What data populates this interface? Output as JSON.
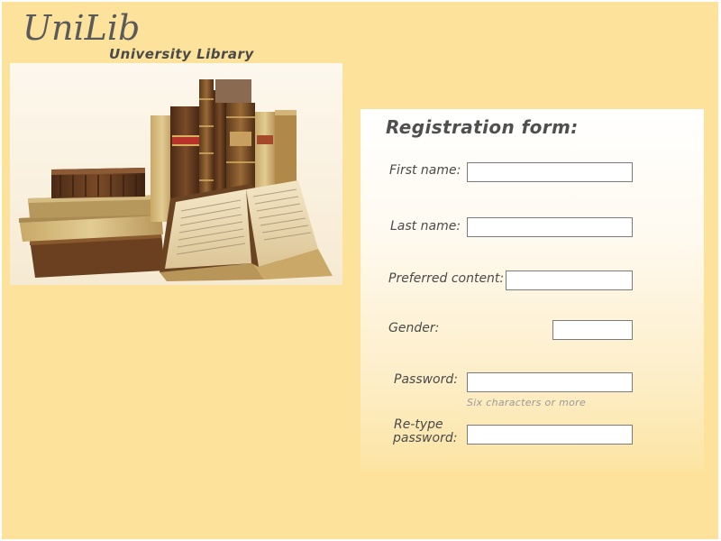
{
  "brand": {
    "name": "UniLib",
    "subtitle": "University Library"
  },
  "hero_image": {
    "icon": "old-books-illustration"
  },
  "form": {
    "title": "Registration form:",
    "fields": {
      "first_name": {
        "label": "First name:",
        "value": ""
      },
      "last_name": {
        "label": "Last name:",
        "value": ""
      },
      "preferred_content": {
        "label": "Preferred content:",
        "value": ""
      },
      "gender": {
        "label": "Gender:",
        "value": ""
      },
      "password": {
        "label": "Password:",
        "value": "",
        "hint": "Six characters or  more"
      },
      "retype_password": {
        "label_line1": "Re-type",
        "label_line2": "password:",
        "value": ""
      }
    }
  },
  "colors": {
    "page_background": "#fce29a",
    "text": "#4a4a4a",
    "field_border": "#7b7b7b",
    "hint_text": "#9a9a9a"
  }
}
